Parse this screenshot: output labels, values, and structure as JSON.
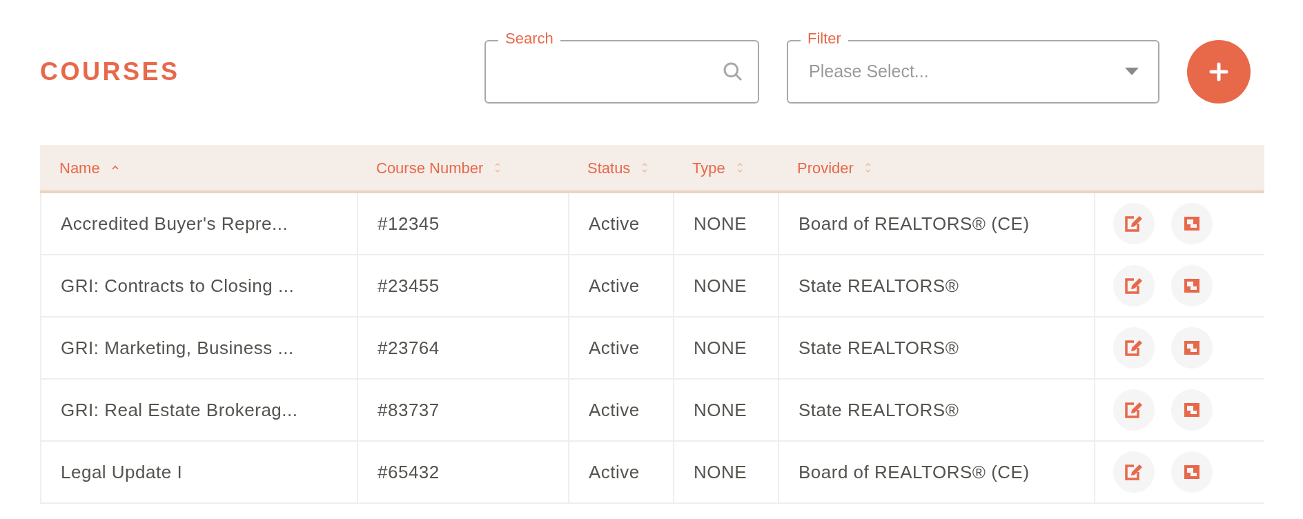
{
  "title": "COURSES",
  "search": {
    "label": "Search"
  },
  "filter": {
    "label": "Filter",
    "placeholder": "Please Select..."
  },
  "table": {
    "columns": [
      {
        "label": "Name",
        "sorted": true
      },
      {
        "label": "Course Number",
        "sorted": false
      },
      {
        "label": "Status",
        "sorted": false
      },
      {
        "label": "Type",
        "sorted": false
      },
      {
        "label": "Provider",
        "sorted": false
      }
    ],
    "rows": [
      {
        "name": "Accredited Buyer's Repre...",
        "number": "#12345",
        "status": "Active",
        "type": "NONE",
        "provider": "Board of REALTORS® (CE)"
      },
      {
        "name": "GRI: Contracts to Closing ...",
        "number": "#23455",
        "status": "Active",
        "type": "NONE",
        "provider": "State REALTORS®"
      },
      {
        "name": "GRI: Marketing, Business ...",
        "number": "#23764",
        "status": "Active",
        "type": "NONE",
        "provider": "State REALTORS®"
      },
      {
        "name": "GRI: Real Estate Brokerag...",
        "number": "#83737",
        "status": "Active",
        "type": "NONE",
        "provider": "State REALTORS®"
      },
      {
        "name": "Legal Update I",
        "number": "#65432",
        "status": "Active",
        "type": "NONE",
        "provider": "Board of REALTORS® (CE)"
      }
    ]
  }
}
